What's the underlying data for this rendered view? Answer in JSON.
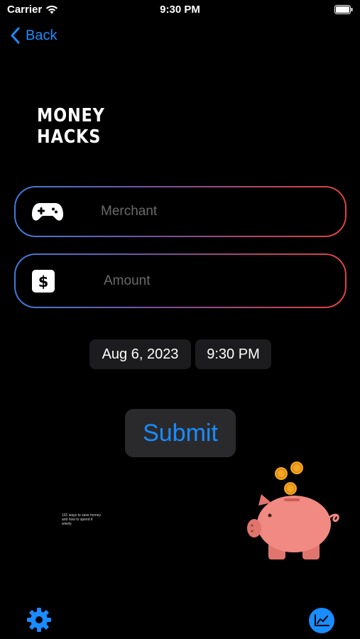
{
  "status_bar": {
    "carrier": "Carrier",
    "time": "9:30 PM"
  },
  "nav": {
    "back_label": "Back"
  },
  "logo": {
    "line1": "MONEY",
    "line2": "HACKS"
  },
  "form": {
    "merchant": {
      "placeholder": "Merchant",
      "value": "",
      "icon": "gamepad-icon"
    },
    "amount": {
      "placeholder": "Amount",
      "value": "",
      "icon": "dollar-icon"
    },
    "date": "Aug 6, 2023",
    "time": "9:30 PM",
    "submit_label": "Submit"
  },
  "illustration": {
    "caption": "101 ways to save money and how to spend it wisely."
  },
  "toolbar": {
    "settings_icon": "gear-icon",
    "chart_icon": "chart-icon"
  },
  "colors": {
    "accent": "#1a8cff",
    "border_start": "#3f7bd8",
    "border_end": "#e0423f",
    "pill_bg": "#1c1c1e",
    "piggy": "#f08a82",
    "coin": "#f2a623"
  }
}
